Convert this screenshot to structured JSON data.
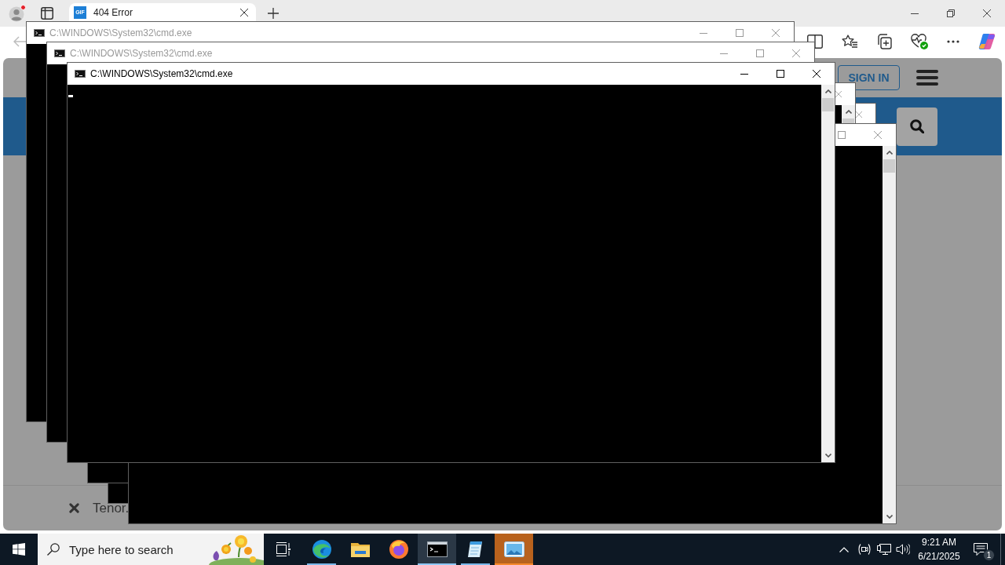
{
  "browser": {
    "tab": {
      "favicon": "GIF",
      "title": "404 Error",
      "selected": true
    },
    "page": {
      "sign_in_button": "SIGN IN",
      "banner_text": "Tenor."
    }
  },
  "console_windows": [
    {
      "title": "C:\\WINDOWS\\System32\\cmd.exe",
      "active": false
    },
    {
      "title": "C:\\WINDOWS\\System32\\cmd.exe",
      "active": false
    },
    {
      "title": "C:\\WINDOWS\\System32\\cmd.exe",
      "active": true
    },
    {
      "active": false
    },
    {
      "active": false
    },
    {
      "active": false
    }
  ],
  "taskbar": {
    "search": {
      "placeholder": "Type here to search"
    },
    "apps": [
      {
        "running": false,
        "selected": false,
        "flashing": false
      },
      {
        "running": true,
        "selected": false,
        "flashing": false
      },
      {
        "running": false,
        "selected": false,
        "flashing": false
      },
      {
        "running": false,
        "selected": false,
        "flashing": false
      },
      {
        "running": true,
        "selected": true,
        "flashing": false
      },
      {
        "running": true,
        "selected": false,
        "flashing": false
      },
      {
        "running": true,
        "selected": false,
        "flashing": true
      }
    ],
    "clock": {
      "time": "9:21 AM",
      "date": "6/21/2025"
    },
    "notifications": {
      "count": "1"
    }
  }
}
